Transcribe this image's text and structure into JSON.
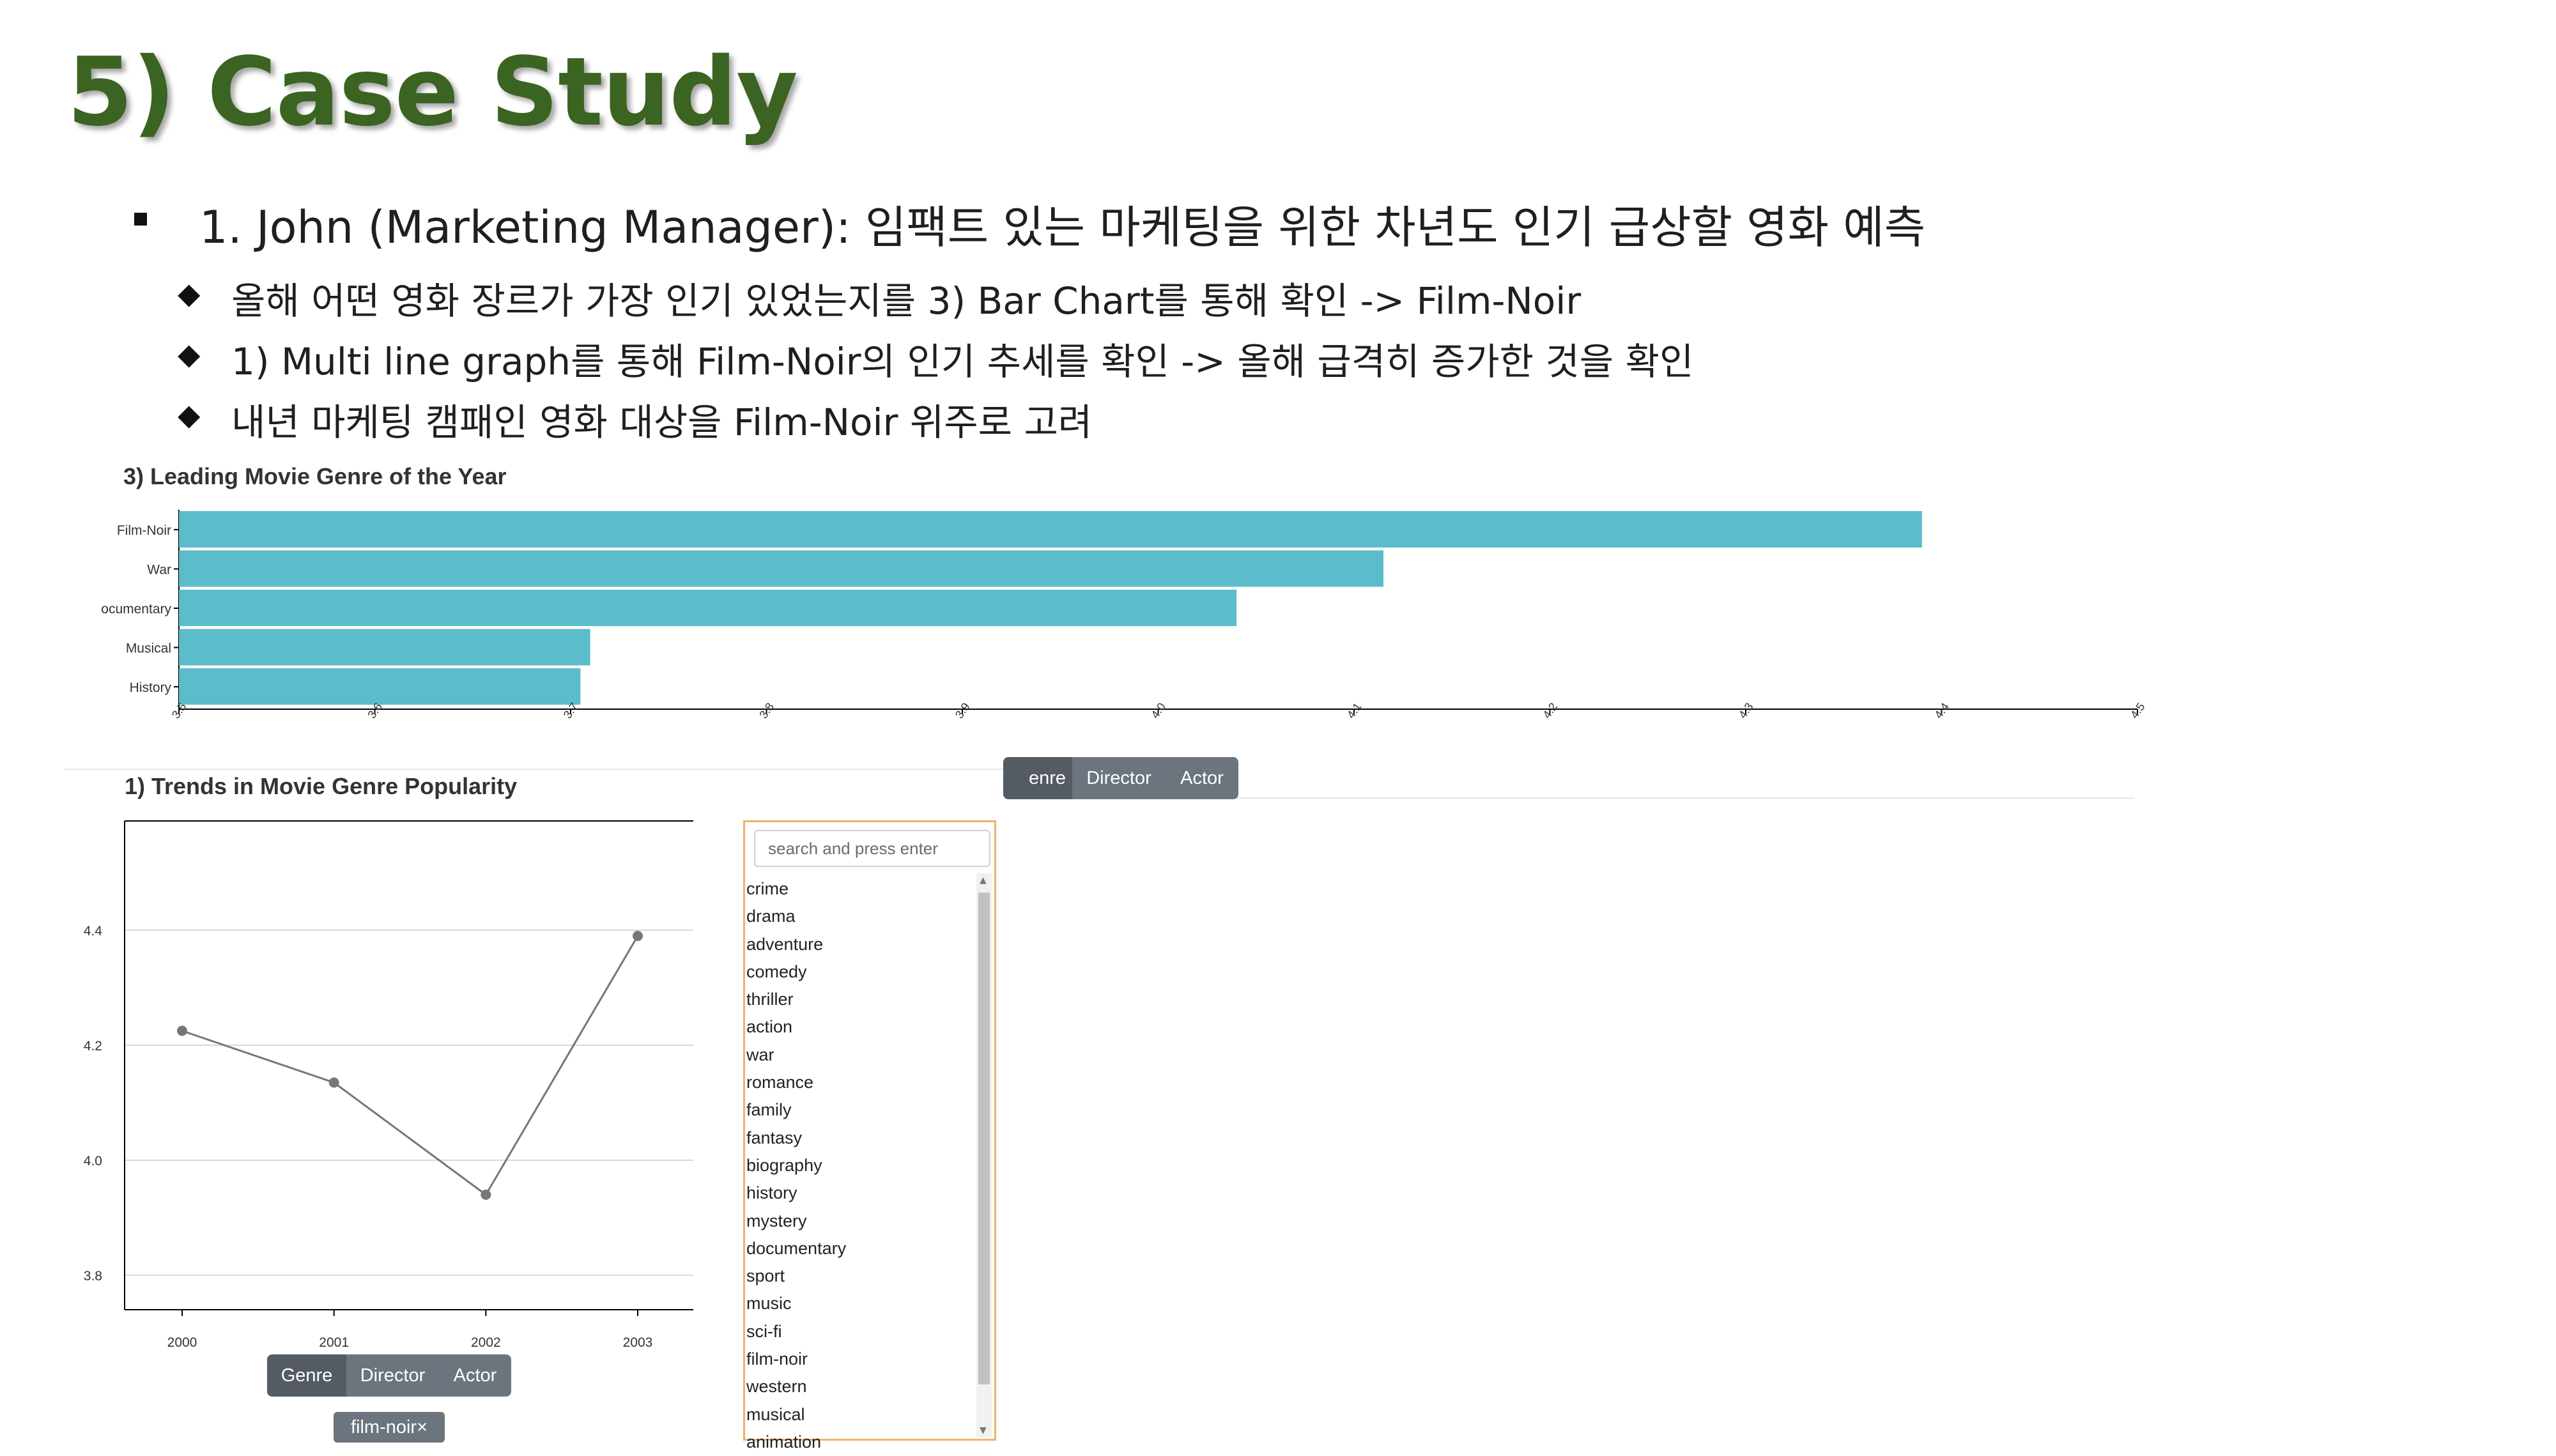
{
  "slide": {
    "title": "5) Case Study",
    "bullet_main": "1. John (Marketing Manager): 임팩트 있는 마케팅을 위한 차년도 인기 급상할 영화 예측",
    "sub_bullets": [
      "올해 어떤 영화 장르가 가장 인기 있었는지를 3) Bar Chart를 통해 확인 -> Film-Noir",
      "1) Multi line graph를 통해 Film-Noir의 인기 추세를 확인 -> 올해 급격히 증가한 것을 확인",
      "내년 마케팅 캠패인 영화 대상을 Film-Noir 위주로 고려"
    ]
  },
  "bar_section": {
    "title": "3) Leading Movie Genre of the Year",
    "buttons": [
      "Genre",
      "Director",
      "Actor"
    ],
    "buttons_visible": [
      "enre",
      "Director",
      "Actor"
    ]
  },
  "line_section": {
    "title": "1) Trends in Movie Genre Popularity",
    "buttons": [
      "Genre",
      "Director",
      "Actor"
    ],
    "selected_tag": "film-noir×"
  },
  "search": {
    "placeholder": "search and press enter",
    "items": [
      "crime",
      "drama",
      "adventure",
      "comedy",
      "thriller",
      "action",
      "war",
      "romance",
      "family",
      "fantasy",
      "biography",
      "history",
      "mystery",
      "documentary",
      "sport",
      "music",
      "sci-fi",
      "film-noir",
      "western",
      "musical",
      "animation"
    ]
  },
  "colors": {
    "title_green": "#3b6321",
    "bar": "#5bbccc",
    "line": "#777777",
    "button": "#6c757d",
    "search_border": "#f0b16a"
  },
  "chart_data": [
    {
      "type": "bar",
      "title": "3) Leading Movie Genre of the Year",
      "orientation": "horizontal",
      "categories": [
        "Film-Noir",
        "War",
        "Documentary",
        "Musical",
        "History"
      ],
      "category_labels_visible": [
        "Film-Noir",
        "War",
        "ocumentary",
        "Musical",
        "History"
      ],
      "values": [
        4.39,
        4.115,
        4.04,
        3.71,
        3.705
      ],
      "xlim": [
        3.5,
        4.5
      ],
      "xticks": [
        "3.5",
        "3.6",
        "3.7",
        "3.8",
        "3.9",
        "4.0",
        "4.1",
        "4.2",
        "4.3",
        "4.4",
        "4.5"
      ],
      "grid": false
    },
    {
      "type": "line",
      "title": "1) Trends in Movie Genre Popularity",
      "x": [
        "2000",
        "2001",
        "2002",
        "2003"
      ],
      "series": [
        {
          "values": [
            4.225,
            4.135,
            3.94,
            4.39
          ]
        }
      ],
      "ylim": [
        3.74,
        4.59
      ],
      "yticks": [
        "3.8",
        "4.0",
        "4.2",
        "4.4"
      ],
      "grid": true
    }
  ]
}
